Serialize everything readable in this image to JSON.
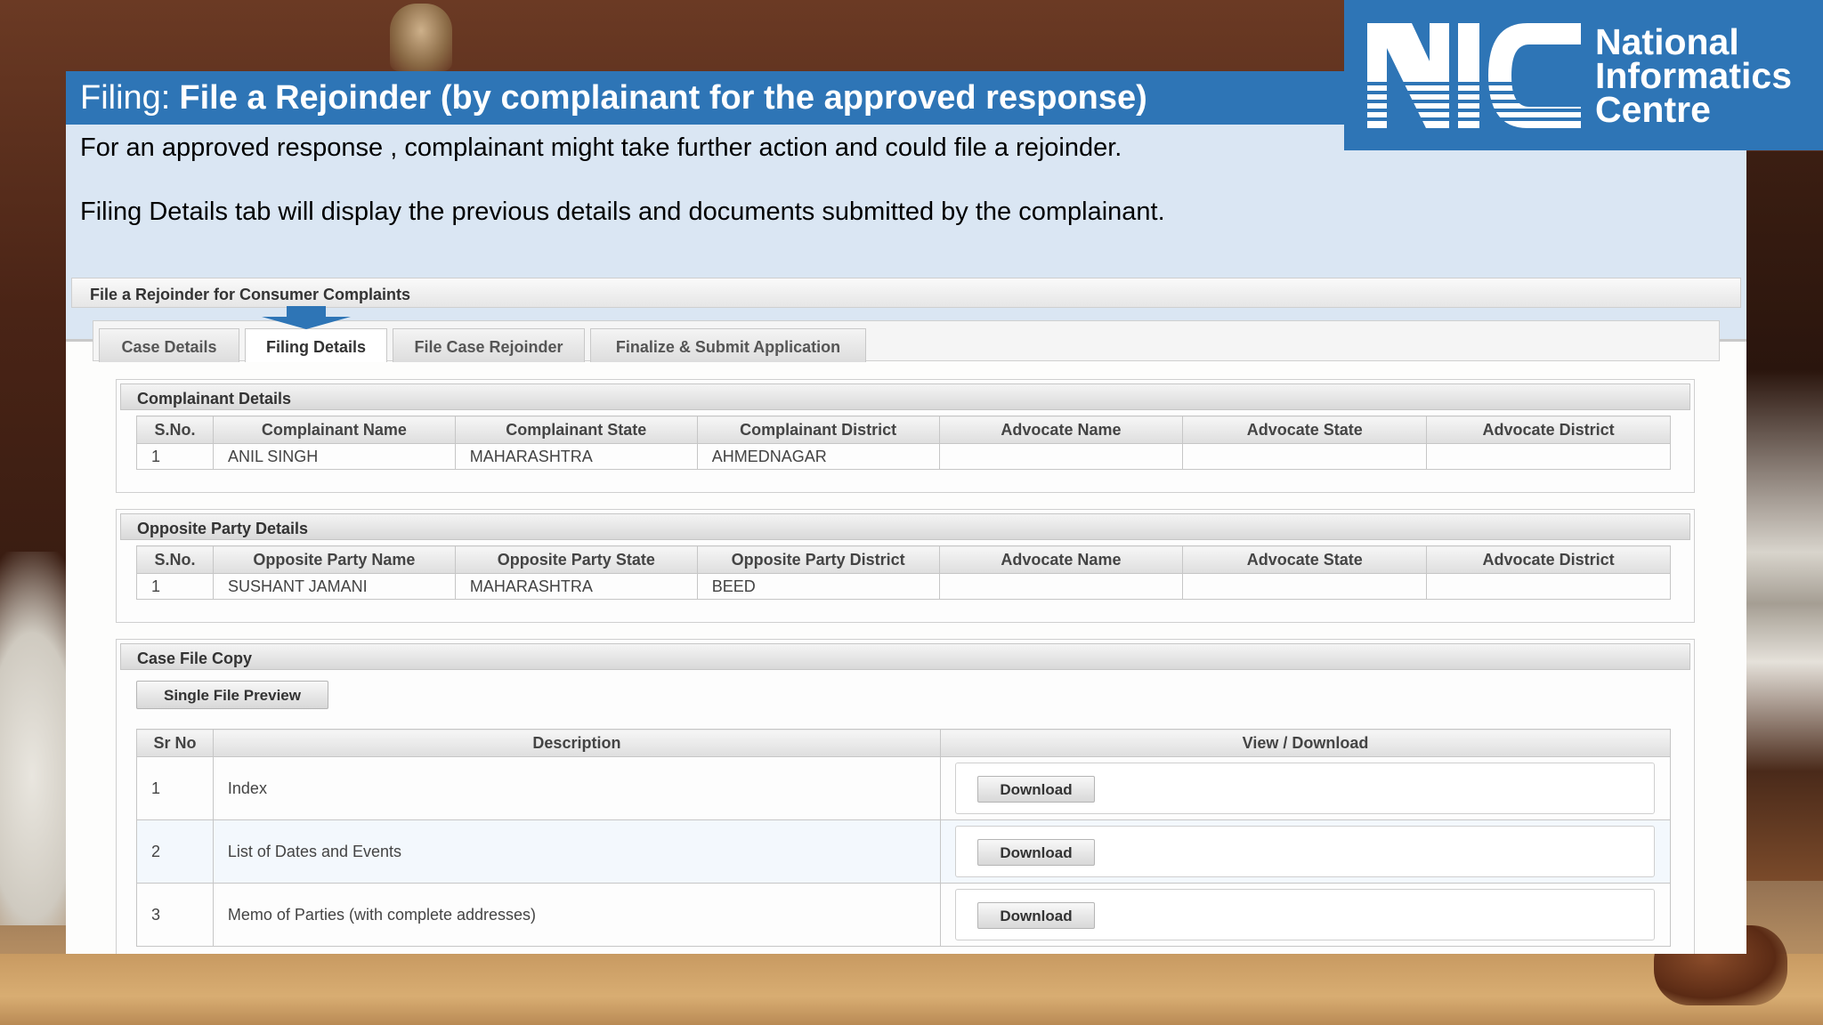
{
  "slide": {
    "title_prefix": "Filing:",
    "title_main": "File a Rejoinder (by complainant for the approved response)",
    "intro_line1": "For an approved response , complainant might take further action and could file a rejoinder.",
    "intro_line2": "Filing Details tab will display the previous details and documents submitted by the complainant."
  },
  "logo": {
    "text_line1": "National",
    "text_line2": "Informatics",
    "text_line3": "Centre",
    "mark": "NIC"
  },
  "form": {
    "header": "File a Rejoinder for Consumer Complaints",
    "tabs": [
      {
        "label": "Case Details",
        "active": false
      },
      {
        "label": "Filing Details",
        "active": true
      },
      {
        "label": "File Case Rejoinder",
        "active": false
      },
      {
        "label": "Finalize & Submit Application",
        "active": false
      }
    ]
  },
  "complainant": {
    "legend": "Complainant Details",
    "headers": [
      "S.No.",
      "Complainant Name",
      "Complainant State",
      "Complainant District",
      "Advocate Name",
      "Advocate State",
      "Advocate District"
    ],
    "rows": [
      [
        "1",
        "ANIL SINGH",
        "MAHARASHTRA",
        "AHMEDNAGAR",
        "",
        "",
        ""
      ]
    ]
  },
  "opposite": {
    "legend": "Opposite Party Details",
    "headers": [
      "S.No.",
      "Opposite Party Name",
      "Opposite Party State",
      "Opposite Party District",
      "Advocate Name",
      "Advocate State",
      "Advocate District"
    ],
    "rows": [
      [
        "1",
        "SUSHANT JAMANI",
        "MAHARASHTRA",
        "BEED",
        "",
        "",
        ""
      ]
    ]
  },
  "case_file": {
    "legend": "Case File Copy",
    "preview_button": "Single File Preview",
    "headers": [
      "Sr No",
      "Description",
      "View / Download"
    ],
    "rows": [
      {
        "sr": "1",
        "description": "Index",
        "action": "Download"
      },
      {
        "sr": "2",
        "description": "List of Dates and Events",
        "action": "Download"
      },
      {
        "sr": "3",
        "description": "Memo of Parties (with complete addresses)",
        "action": "Download"
      }
    ]
  },
  "colors": {
    "accent": "#2e75b6",
    "intro_bg": "#dae6f3"
  }
}
